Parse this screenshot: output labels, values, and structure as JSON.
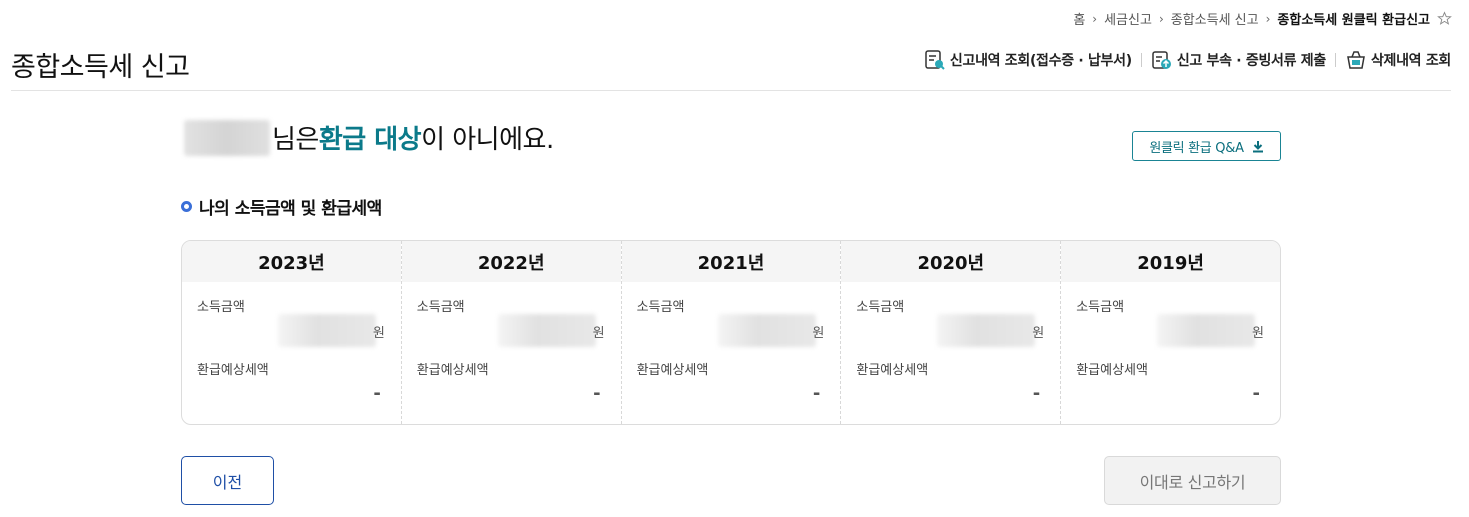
{
  "breadcrumb": {
    "items": [
      "홈",
      "세금신고",
      "종합소득세 신고",
      "종합소득세 원클릭 환급신고"
    ]
  },
  "header": {
    "title": "종합소득세 신고",
    "links": [
      {
        "label": "신고내역 조회(접수증 · 납부서)",
        "icon": "document-search-icon"
      },
      {
        "label": "신고 부속 · 증빙서류 제출",
        "icon": "document-upload-icon"
      },
      {
        "label": "삭제내역 조회",
        "icon": "trash-basket-icon"
      }
    ]
  },
  "headline": {
    "suffix": "님은 ",
    "highlight": "환급 대상",
    "rest": "이 아니에요."
  },
  "qa_button": {
    "label": "원클릭 환급 Q&A",
    "icon": "download-icon"
  },
  "section": {
    "title": "나의 소득금액 및 환급세액"
  },
  "cards": [
    {
      "year": "2023년",
      "income_label": "소득금액",
      "unit": "원",
      "refund_label": "환급예상세액",
      "refund_value": "-"
    },
    {
      "year": "2022년",
      "income_label": "소득금액",
      "unit": "원",
      "refund_label": "환급예상세액",
      "refund_value": "-"
    },
    {
      "year": "2021년",
      "income_label": "소득금액",
      "unit": "원",
      "refund_label": "환급예상세액",
      "refund_value": "-"
    },
    {
      "year": "2020년",
      "income_label": "소득금액",
      "unit": "원",
      "refund_label": "환급예상세액",
      "refund_value": "-"
    },
    {
      "year": "2019년",
      "income_label": "소득금액",
      "unit": "원",
      "refund_label": "환급예상세액",
      "refund_value": "-"
    }
  ],
  "buttons": {
    "prev": "이전",
    "submit": "이대로 신고하기"
  },
  "colors": {
    "accent_teal": "#0b7a8a",
    "primary_blue": "#1f4fa6",
    "bullet_blue": "#3a6fd8"
  }
}
